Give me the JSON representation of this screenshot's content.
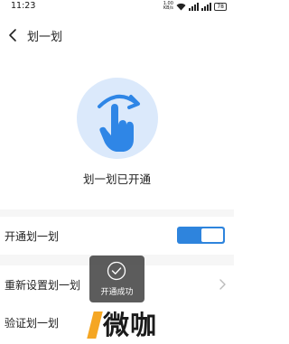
{
  "status_bar": {
    "time": "11:23",
    "net_speed_value": "1.00",
    "net_speed_unit": "KB/s",
    "battery": "78"
  },
  "nav": {
    "title": "划一划",
    "back_icon": "back-chevron-icon"
  },
  "hero": {
    "icon": "swipe-hand-icon",
    "status_text": "划一划已开通"
  },
  "settings": {
    "enable_label": "开通划一划",
    "enable_state": "on",
    "reset_label": "重新设置划一划",
    "verify_label": "验证划一划"
  },
  "toast": {
    "icon": "check-circle-icon",
    "text": "开通成功"
  },
  "watermark": {
    "text": "微咖"
  },
  "colors": {
    "accent": "#2e84dd",
    "circle_bg": "#dbe9fb",
    "hand": "#2f86e6",
    "watermark_accent": "#f5a623"
  }
}
